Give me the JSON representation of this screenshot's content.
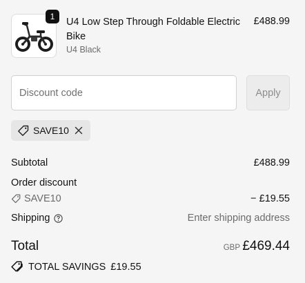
{
  "product": {
    "quantity": "1",
    "name": "U4 Low Step Through Foldable Electric Bike",
    "variant": "U4 Black",
    "price": "£488.99",
    "image_icon": "electric-bike-thumbnail"
  },
  "discount": {
    "placeholder": "Discount code",
    "value": "",
    "apply_label": "Apply",
    "applied_code": "SAVE10"
  },
  "summary": {
    "subtotal_label": "Subtotal",
    "subtotal_value": "£488.99",
    "order_discount_label": "Order discount",
    "order_discount_code": "SAVE10",
    "order_discount_value": "− £19.55",
    "shipping_label": "Shipping",
    "shipping_value": "Enter shipping address",
    "total_label": "Total",
    "currency": "GBP",
    "total_value": "£469.44",
    "savings_label": "TOTAL SAVINGS",
    "savings_value": "£19.55"
  },
  "icons": [
    "tag-icon",
    "close-icon",
    "help-circle-icon",
    "tags-icon"
  ]
}
